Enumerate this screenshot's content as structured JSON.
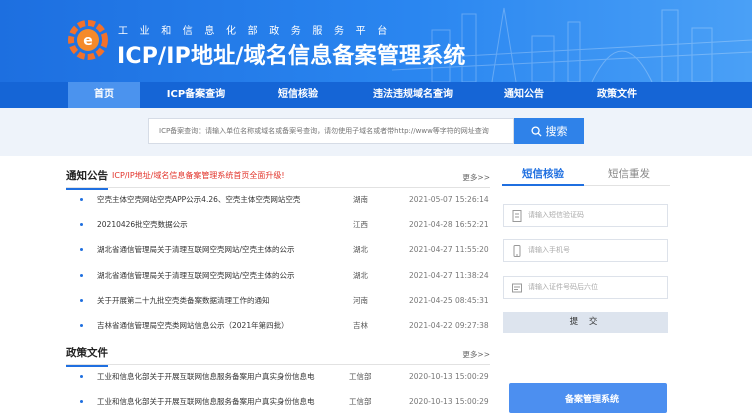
{
  "header": {
    "subtitle": "工业和信息化部政务服务平台",
    "title": "ICP/IP地址/域名信息备案管理系统",
    "brand_color": "#1d6fe0"
  },
  "nav": {
    "items": [
      {
        "label": "首页",
        "active": true
      },
      {
        "label": "ICP备案查询",
        "active": false
      },
      {
        "label": "短信核验",
        "active": false
      },
      {
        "label": "违法违规域名查询",
        "active": false
      },
      {
        "label": "通知公告",
        "active": false
      },
      {
        "label": "政策文件",
        "active": false
      }
    ]
  },
  "search": {
    "placeholder": "ICP备案查询：请输入单位名称或域名或备案号查询，请勿使用子域名或者带http://www等字符的网址查询",
    "button_label": "搜索",
    "button_icon": "search-icon"
  },
  "notices": {
    "title": "通知公告",
    "alert": "ICP/IP地址/域名信息备案管理系统首页全面升级!",
    "more": "更多>>",
    "items": [
      {
        "text": "空壳主体空壳网站空壳APP公示4.26、空壳主体空壳网站空壳",
        "region": "湖南",
        "date": "2021-05-07 15:26:14"
      },
      {
        "text": "20210426批空壳数据公示",
        "region": "江西",
        "date": "2021-04-28 16:52:21"
      },
      {
        "text": "湖北省通信管理局关于清理互联网空壳网站/空壳主体的公示",
        "region": "湖北",
        "date": "2021-04-27 11:55:20"
      },
      {
        "text": "湖北省通信管理局关于清理互联网空壳网站/空壳主体的公示",
        "region": "湖北",
        "date": "2021-04-27 11:38:24"
      },
      {
        "text": "关于开展第二十九批空壳类备案数据清理工作的通知",
        "region": "河南",
        "date": "2021-04-25 08:45:31"
      },
      {
        "text": "吉林省通信管理局空壳类网站信息公示（2021年第四批）",
        "region": "吉林",
        "date": "2021-04-22 09:27:38"
      }
    ]
  },
  "policies": {
    "title": "政策文件",
    "more": "更多>>",
    "items": [
      {
        "text": "工业和信息化部关于开展互联网信息服务备案用户真实身份信息电",
        "region": "工信部",
        "date": "2020-10-13 15:00:29"
      },
      {
        "text": "工业和信息化部关于开展互联网信息服务备案用户真实身份信息电",
        "region": "工信部",
        "date": "2020-10-13 15:00:29"
      }
    ]
  },
  "sms_panel": {
    "tabs": [
      {
        "label": "短信核验",
        "active": true
      },
      {
        "label": "短信重发",
        "active": false
      }
    ],
    "fields": [
      {
        "placeholder": "请输入短信验证码",
        "icon": "document-icon"
      },
      {
        "placeholder": "请输入手机号",
        "icon": "phone-icon"
      },
      {
        "placeholder": "请输入证件号码后六位",
        "icon": "id-card-icon"
      }
    ],
    "submit_label": "提 交",
    "bottom_card_label": "备案管理系统"
  }
}
